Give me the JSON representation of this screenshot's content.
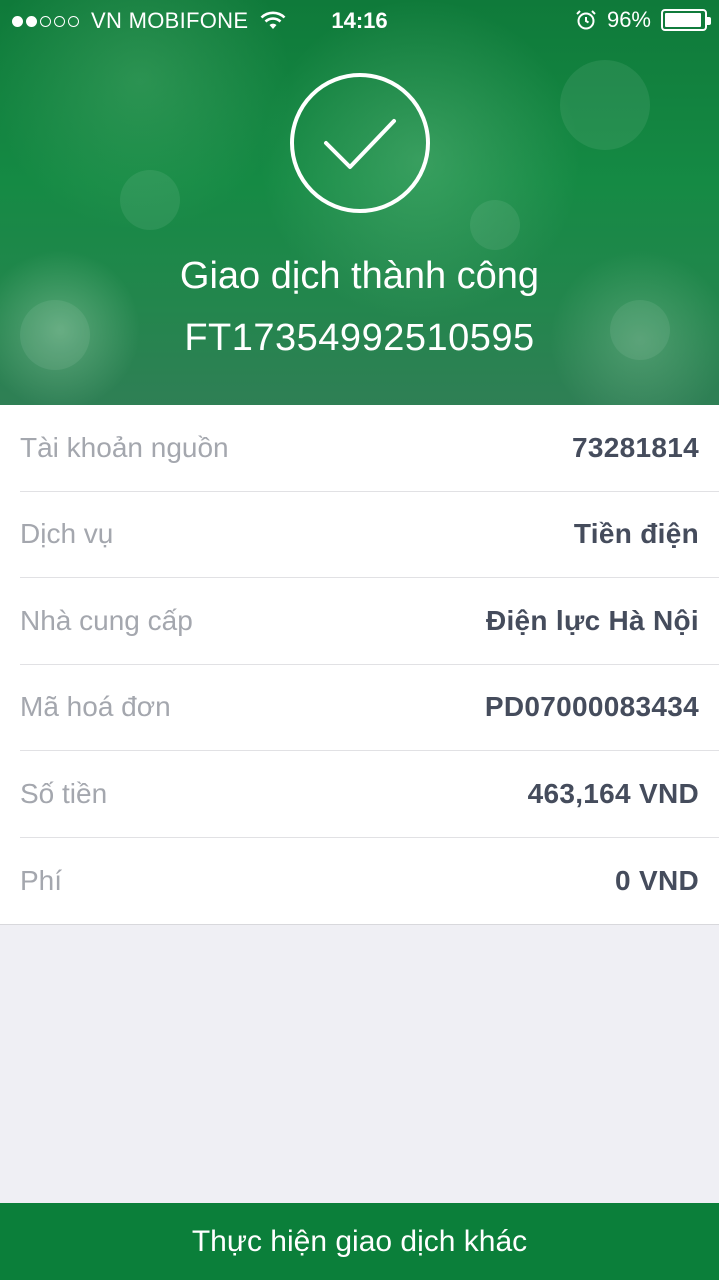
{
  "status_bar": {
    "signal_dots_filled": 2,
    "signal_dots_total": 5,
    "carrier": "VN MOBIFONE",
    "time": "14:16",
    "battery_percent": "96%",
    "battery_level": 0.96,
    "icons": [
      "signal-dots-icon",
      "wifi-icon",
      "alarm-clock-icon",
      "battery-icon"
    ]
  },
  "result": {
    "icon": "checkmark-circle-icon",
    "title": "Giao dịch thành công",
    "transaction_id": "FT17354992510595"
  },
  "details": [
    {
      "label": "Tài khoản nguồn",
      "value": "73281814"
    },
    {
      "label": "Dịch vụ",
      "value": "Tiền điện"
    },
    {
      "label": "Nhà cung cấp",
      "value": "Điện lực Hà Nội"
    },
    {
      "label": "Mã hoá đơn",
      "value": "PD07000083434"
    },
    {
      "label": "Số tiền",
      "value": "463,164 VND"
    },
    {
      "label": "Phí",
      "value": "0 VND"
    }
  ],
  "action": {
    "button_label": "Thực hiện giao dịch khác"
  },
  "colors": {
    "brand_green": "#0b7f3a",
    "label_gray": "#a4a7ae",
    "value_dark": "#454c5c",
    "background": "#efeff4"
  }
}
